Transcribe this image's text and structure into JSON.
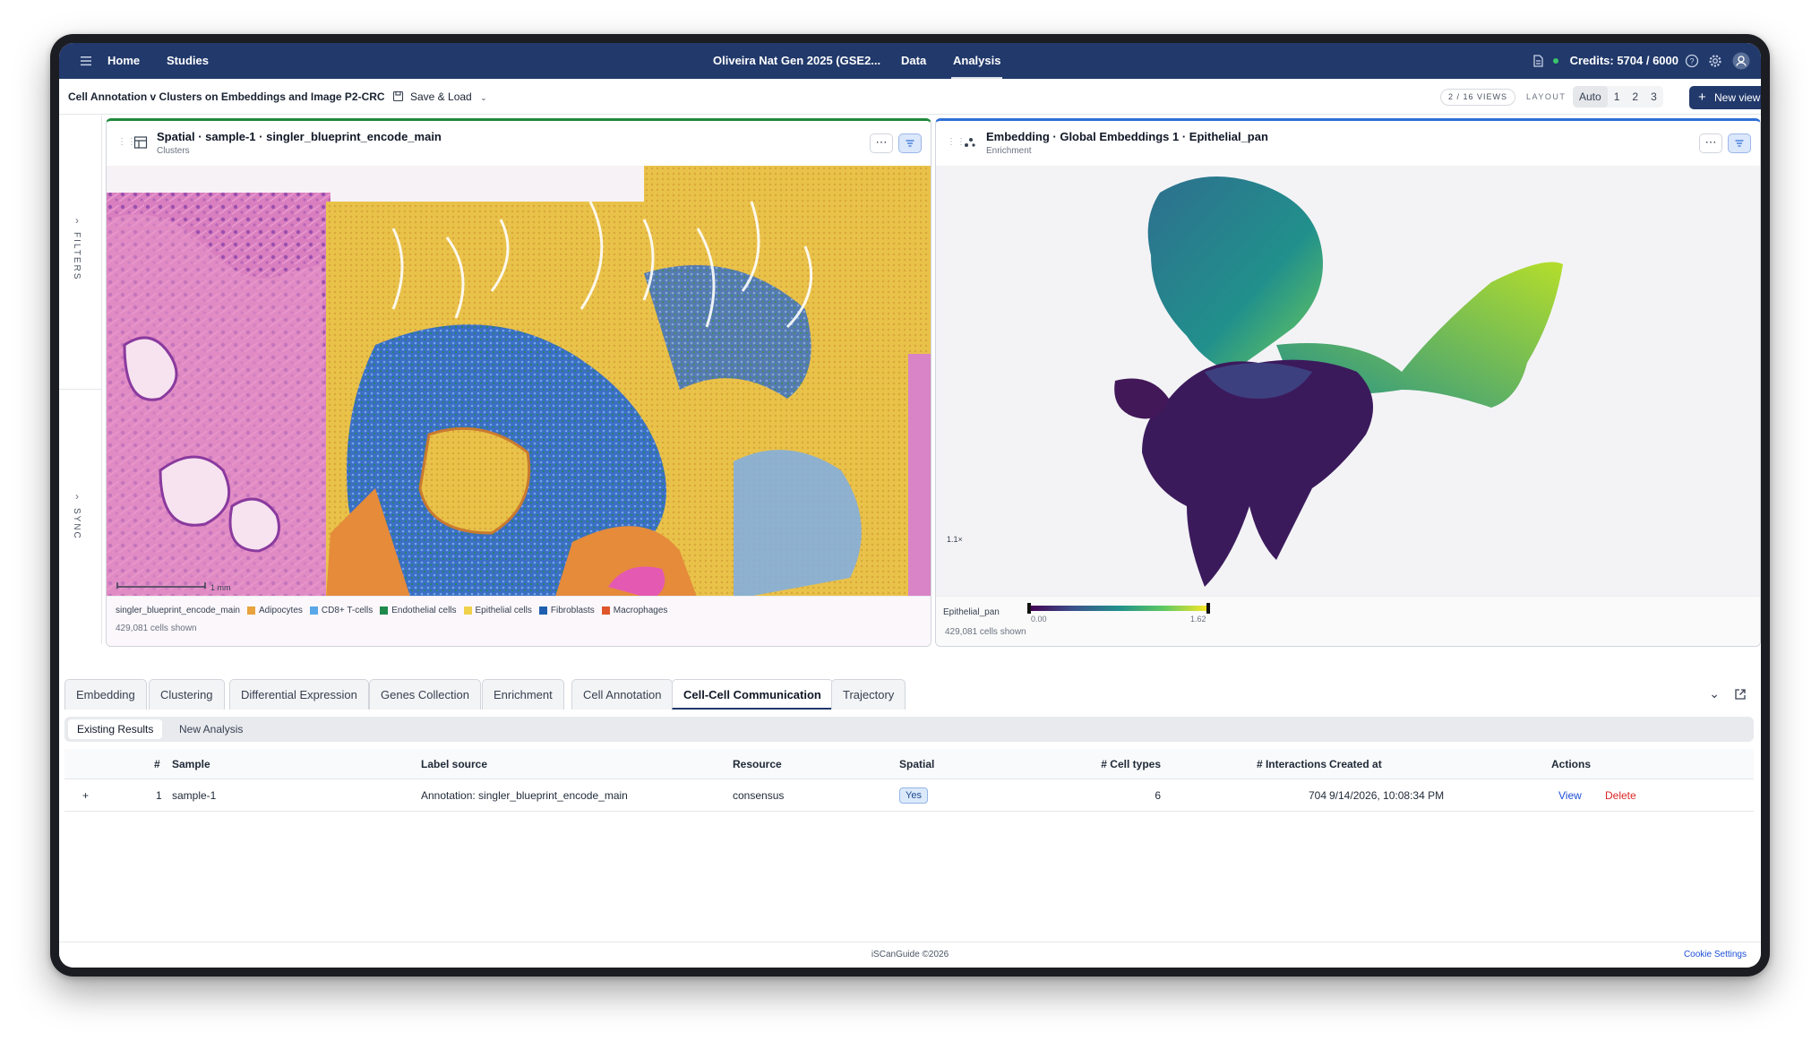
{
  "nav": {
    "home": "Home",
    "studies": "Studies",
    "study_title": "Oliveira Nat Gen 2025 (GSE2...",
    "data": "Data",
    "analysis": "Analysis",
    "credits": "Credits: 5704 / 6000"
  },
  "toolbar": {
    "title": "Cell Annotation v Clusters on Embeddings and Image P2-CRC",
    "save_load": "Save & Load",
    "views_count": "2 / 16 VIEWS",
    "layout_label": "LAYOUT",
    "layout_options": [
      "Auto",
      "1",
      "2",
      "3"
    ],
    "new_view": "New view"
  },
  "rail": {
    "filters": "FILTERS",
    "sync": "SYNC"
  },
  "left_panel": {
    "title": "Spatial · sample-1 · singler_blueprint_encode_main",
    "subtitle": "Clusters",
    "scale_bar": "1 mm",
    "legend_title": "singler_blueprint_encode_main",
    "legend": [
      {
        "label": "Adipocytes",
        "color": "#e8a33c"
      },
      {
        "label": "CD8+ T-cells",
        "color": "#5aa7e8"
      },
      {
        "label": "Endothelial cells",
        "color": "#1f8a4c"
      },
      {
        "label": "Epithelial cells",
        "color": "#f0d24a"
      },
      {
        "label": "Fibroblasts",
        "color": "#1f5fb0"
      },
      {
        "label": "Macrophages",
        "color": "#e0562a"
      }
    ],
    "cells_shown": "429,081 cells shown"
  },
  "right_panel": {
    "title": "Embedding · Global Embeddings 1 · Epithelial_pan",
    "subtitle": "Enrichment",
    "zoom": "1.1×",
    "colorbar_label": "Epithelial_pan",
    "colorbar_min": "0.00",
    "colorbar_max": "1.62",
    "cells_shown": "429,081 cells shown"
  },
  "tabs": [
    "Embedding",
    "Clustering",
    "Differential Expression",
    "Genes Collection",
    "Enrichment",
    "Cell Annotation",
    "Cell-Cell Communication",
    "Trajectory"
  ],
  "active_tab": "Cell-Cell Communication",
  "subtabs": [
    "Existing Results",
    "New Analysis"
  ],
  "table": {
    "headers": [
      "#",
      "Sample",
      "Label source",
      "Resource",
      "Spatial",
      "# Cell types",
      "# Interactions",
      "Created at",
      "Actions"
    ],
    "rows": [
      {
        "expand": "+",
        "num": "1",
        "sample": "sample-1",
        "label_source": "Annotation: singler_blueprint_encode_main",
        "resource": "consensus",
        "spatial": "Yes",
        "cell_types": "6",
        "interactions": "704",
        "created_at": "9/14/2026, 10:08:34 PM",
        "view": "View",
        "delete": "Delete"
      }
    ]
  },
  "footer": {
    "copyright": "iSCanGuide ©2026",
    "cookie": "Cookie Settings"
  }
}
